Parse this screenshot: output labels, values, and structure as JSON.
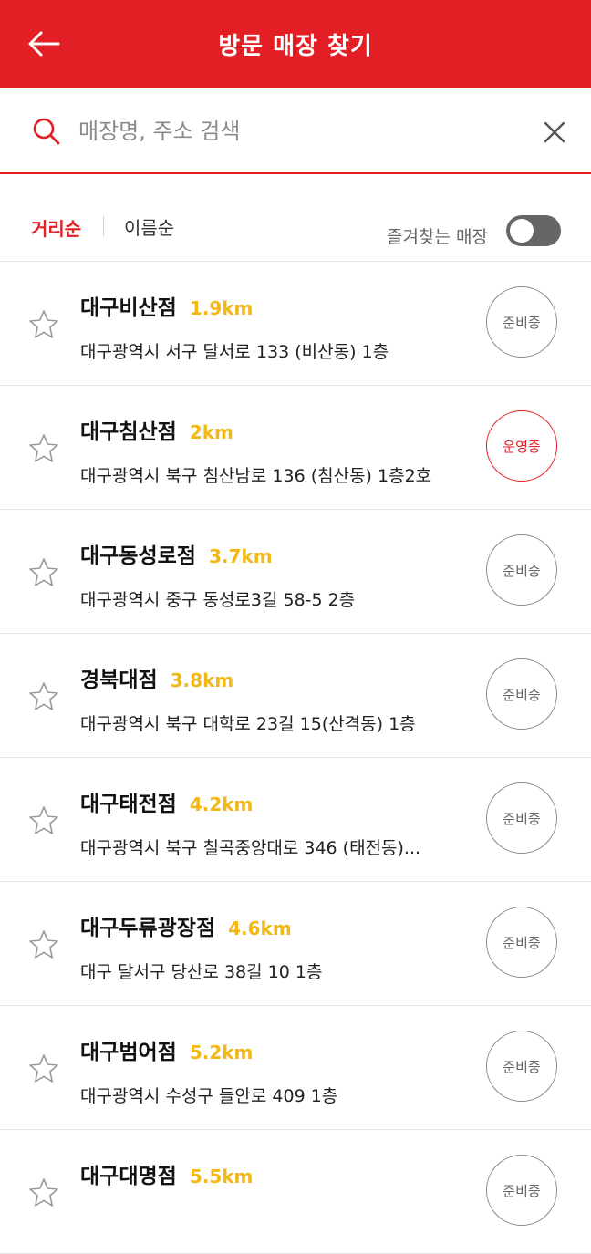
{
  "header": {
    "title": "방문 매장 찾기"
  },
  "search": {
    "placeholder": "매장명, 주소 검색",
    "value": ""
  },
  "sort": {
    "distance_label": "거리순",
    "name_label": "이름순"
  },
  "favorites_toggle": {
    "label": "즐겨찾는 매장",
    "on": false
  },
  "colors": {
    "brand": "#e31e24",
    "distance": "#f3b817",
    "closed": "#8a8a8a"
  },
  "stores": [
    {
      "name": "대구비산점",
      "distance": "1.9km",
      "address": "대구광역시 서구 달서로 133 (비산동) 1층",
      "status": "준비중",
      "open": false
    },
    {
      "name": "대구침산점",
      "distance": "2km",
      "address": "대구광역시 북구 침산남로 136 (침산동) 1층2호",
      "status": "운영중",
      "open": true
    },
    {
      "name": "대구동성로점",
      "distance": "3.7km",
      "address": "대구광역시 중구 동성로3길 58-5 2층",
      "status": "준비중",
      "open": false
    },
    {
      "name": "경북대점",
      "distance": "3.8km",
      "address": "대구광역시 북구 대학로 23길 15(산격동) 1층",
      "status": "준비중",
      "open": false
    },
    {
      "name": "대구태전점",
      "distance": "4.2km",
      "address": "대구광역시 북구 칠곡중앙대로 346 (태전동)...",
      "status": "준비중",
      "open": false
    },
    {
      "name": "대구두류광장점",
      "distance": "4.6km",
      "address": "대구 달서구 당산로 38길 10 1층",
      "status": "준비중",
      "open": false
    },
    {
      "name": "대구범어점",
      "distance": "5.2km",
      "address": "대구광역시 수성구 들안로 409 1층",
      "status": "준비중",
      "open": false
    },
    {
      "name": "대구대명점",
      "distance": "5.5km",
      "address": "",
      "status": "준비중",
      "open": false
    }
  ]
}
